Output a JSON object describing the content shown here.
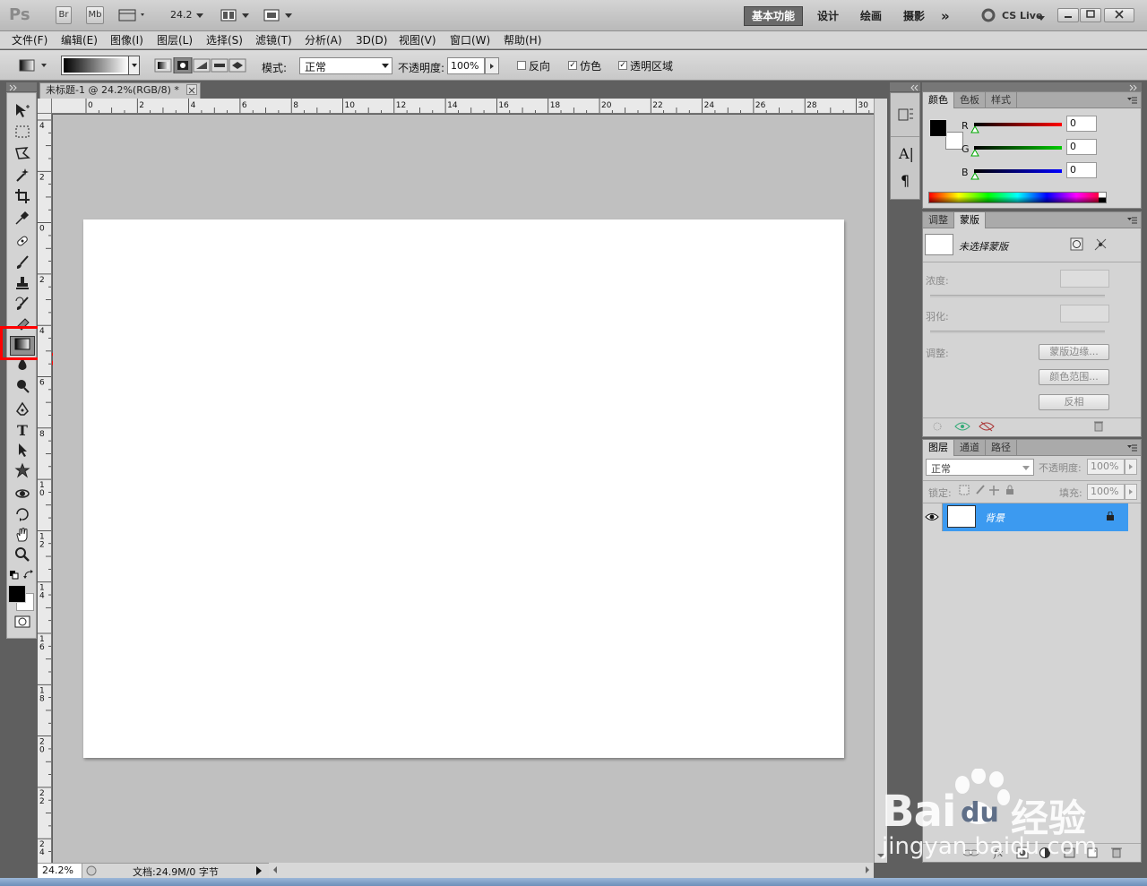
{
  "titlebar": {
    "ps_logo": "Ps",
    "br": "Br",
    "mb": "Mb",
    "zoom": "24.2",
    "workspaces": [
      "基本功能",
      "设计",
      "绘画",
      "摄影"
    ],
    "more": "»",
    "cslive": "CS Live"
  },
  "menu": [
    "文件(F)",
    "编辑(E)",
    "图像(I)",
    "图层(L)",
    "选择(S)",
    "滤镜(T)",
    "分析(A)",
    "3D(D)",
    "视图(V)",
    "窗口(W)",
    "帮助(H)"
  ],
  "options": {
    "mode_label": "模式:",
    "mode_value": "正常",
    "opacity_label": "不透明度:",
    "opacity_value": "100%",
    "reverse_label": "反向",
    "dither_label": "仿色",
    "transparency_label": "透明区域"
  },
  "document": {
    "tab_title": "未标题-1 @ 24.2%(RGB/8) *",
    "status_zoom": "24.2%",
    "status_doc": "文档:24.9M/0 字节",
    "ruler_top": [
      "0",
      "2",
      "4",
      "6",
      "8",
      "10",
      "12",
      "14",
      "16",
      "18",
      "20",
      "22",
      "24",
      "26",
      "28",
      "30"
    ],
    "ruler_left": [
      "4",
      "2",
      "0",
      "2",
      "4",
      "6",
      "8",
      "1\n0",
      "1\n2",
      "1\n4",
      "1\n6",
      "1\n8",
      "2\n0",
      "2\n2",
      "2\n4"
    ]
  },
  "color_panel": {
    "tabs": [
      "颜色",
      "色板",
      "样式"
    ],
    "r_label": "R",
    "g_label": "G",
    "b_label": "B",
    "r_value": "0",
    "g_value": "0",
    "b_value": "0"
  },
  "masks_panel": {
    "tabs": [
      "调整",
      "蒙版"
    ],
    "no_mask": "未选择蒙版",
    "density_label": "浓度:",
    "feather_label": "羽化:",
    "refine_label": "调整:",
    "mask_edge_btn": "蒙版边缘...",
    "color_range_btn": "颜色范围...",
    "invert_btn": "反相"
  },
  "layers_panel": {
    "tabs": [
      "图层",
      "通道",
      "路径"
    ],
    "blend_mode": "正常",
    "opacity_label": "不透明度:",
    "opacity_value": "100%",
    "lock_label": "锁定:",
    "fill_label": "填充:",
    "fill_value": "100%",
    "layer_name": "背景"
  },
  "watermark": {
    "brand": "Bai",
    "brand2": "du",
    "cn": "经验",
    "url": "jingyan.baidu.com"
  },
  "colors": {
    "highlight_red": "#ff0000",
    "layer_selected": "#3c9af0"
  }
}
